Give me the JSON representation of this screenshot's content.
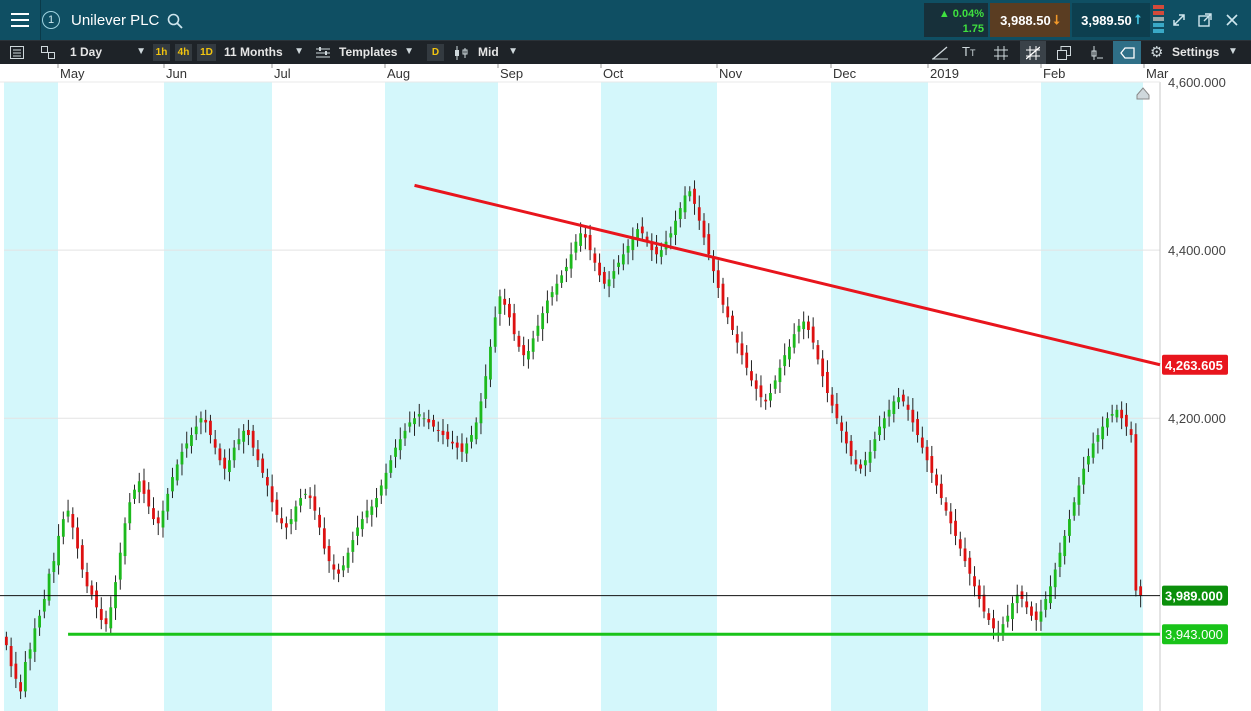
{
  "window": {
    "title": "Unilever PLC",
    "badge": "1",
    "change_pct": "▲ 0.04%",
    "change_abs": "1.75",
    "sell_price": "3,988.50",
    "buy_price": "3,989.50"
  },
  "toolbar": {
    "interval": "1 Day",
    "quick_1h": "1h",
    "quick_4h": "4h",
    "quick_1d": "1D",
    "range": "11 Months",
    "templates": "Templates",
    "d_btn": "D",
    "price_type": "Mid",
    "settings": "Settings"
  },
  "colors": {
    "up": "#1db91d",
    "down": "#dd1111",
    "trend": "#e8151d",
    "support": "#19c319",
    "band": "#d4f7fb",
    "topbar": "#0f4f63"
  },
  "chart_data": {
    "type": "candlestick",
    "months": [
      "May",
      "Jun",
      "Jul",
      "Aug",
      "Sep",
      "Oct",
      "Nov",
      "Dec",
      "2019",
      "Feb",
      "Mar"
    ],
    "y_ticks": [
      "4,600.000",
      "4,400.000",
      "4,200.000",
      "3,989.000"
    ],
    "ylim": [
      3860,
      4600
    ],
    "grid": true,
    "last_price_label": "3,989.000",
    "last_price": 3989,
    "trendline_label": "4,263.605",
    "trendline_value": 4263.605,
    "support_label": "3,943.000",
    "support_value": 3943,
    "trendline_points": [
      [
        86,
        4477
      ],
      [
        240,
        4263.605
      ]
    ],
    "support_points": [
      [
        13,
        3943
      ],
      [
        240,
        3943
      ]
    ],
    "bar_count": 240,
    "closes": [
      3930,
      3905,
      3890,
      3875,
      3910,
      3925,
      3950,
      3965,
      3985,
      4015,
      4030,
      4060,
      4080,
      4090,
      4070,
      4045,
      4020,
      4000,
      3990,
      3975,
      3960,
      3955,
      3975,
      4005,
      4040,
      4075,
      4100,
      4115,
      4125,
      4110,
      4095,
      4080,
      4075,
      4090,
      4110,
      4130,
      4145,
      4160,
      4170,
      4180,
      4190,
      4200,
      4195,
      4180,
      4165,
      4150,
      4140,
      4150,
      4165,
      4175,
      4185,
      4180,
      4165,
      4150,
      4135,
      4120,
      4100,
      4085,
      4075,
      4070,
      4080,
      4095,
      4105,
      4110,
      4105,
      4090,
      4070,
      4045,
      4030,
      4020,
      4015,
      4025,
      4040,
      4055,
      4070,
      4080,
      4090,
      4095,
      4105,
      4120,
      4135,
      4150,
      4165,
      4175,
      4185,
      4195,
      4200,
      4205,
      4200,
      4195,
      4190,
      4185,
      4180,
      4175,
      4170,
      4165,
      4160,
      4170,
      4180,
      4195,
      4220,
      4250,
      4285,
      4320,
      4345,
      4335,
      4320,
      4300,
      4285,
      4275,
      4280,
      4295,
      4310,
      4325,
      4340,
      4350,
      4360,
      4370,
      4380,
      4395,
      4410,
      4420,
      4415,
      4400,
      4385,
      4370,
      4360,
      4365,
      4375,
      4385,
      4395,
      4405,
      4415,
      4425,
      4420,
      4410,
      4400,
      4395,
      4400,
      4410,
      4420,
      4435,
      4450,
      4465,
      4470,
      4455,
      4435,
      4415,
      4395,
      4375,
      4355,
      4335,
      4320,
      4305,
      4290,
      4275,
      4260,
      4245,
      4235,
      4225,
      4220,
      4230,
      4245,
      4260,
      4275,
      4285,
      4300,
      4310,
      4315,
      4305,
      4290,
      4270,
      4250,
      4230,
      4215,
      4200,
      4185,
      4170,
      4155,
      4145,
      4140,
      4150,
      4160,
      4175,
      4190,
      4200,
      4210,
      4220,
      4225,
      4220,
      4210,
      4195,
      4180,
      4165,
      4150,
      4135,
      4120,
      4105,
      4090,
      4075,
      4060,
      4045,
      4030,
      4015,
      4000,
      3985,
      3970,
      3960,
      3950,
      3945,
      3955,
      3965,
      3980,
      3990,
      3985,
      3975,
      3965,
      3960,
      3970,
      3985,
      4000,
      4020,
      4040,
      4060,
      4080,
      4100,
      4120,
      4140,
      4155,
      4170,
      4180,
      4190,
      4200,
      4205,
      4210,
      4200,
      4190,
      4180,
      3995,
      3989
    ]
  }
}
